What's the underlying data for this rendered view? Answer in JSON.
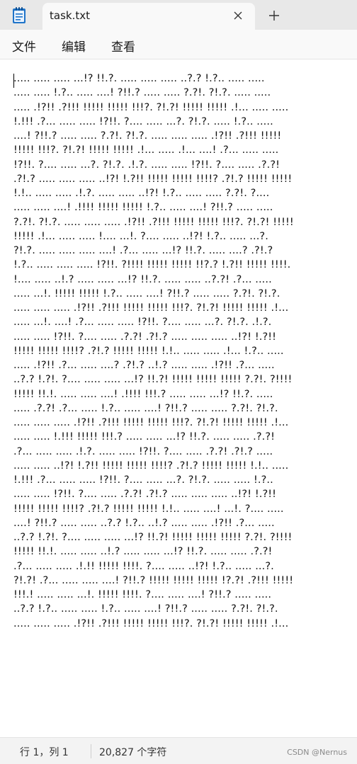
{
  "tab": {
    "title": "task.txt",
    "close_icon": "close-icon",
    "new_tab_icon": "plus-icon"
  },
  "menu": {
    "items": [
      "文件",
      "编辑",
      "查看"
    ]
  },
  "document": {
    "lines": [
      "..... ..... ..... ...!? !!.?. ..... ..... ..... ..?.? !.?.. ..... .....",
      "..... ..... !.?.. ..... ....! ?!!.? ..... ..... ?.?!. ?!.?. ..... .....",
      "..... .!?!! .?!!! !!!!! !!!!! !!!?. ?!.?! !!!!! !!!!! .!... ..... .....",
      "!.!!! .?... ..... ..... !?!!. ?.... ..... ...?. ?!.?. ..... !.?.. .....",
      "....! ?!!.? ..... ..... ?.?!. ?!.?. ..... ..... ..... .!?!! .?!!! !!!!!",
      "!!!!! !!!?. ?!.?! !!!!! !!!!! .!... ..... .!... ....! .?... ..... .....",
      "!?!!. ?.... ..... ...?. ?!.?. .!.?. ..... ..... !?!!. ?.... ..... .?.?!",
      ".?!.? ..... ..... ..... ..!?! !.?!! !!!!! !!!!! !!!!? .?!.? !!!!! !!!!!",
      "!.!.. ..... ..... .!.?. ..... ..... ..!?! !.?.. ..... ..... ?.?!. ?....",
      "..... ..... ....! .!!!! !!!!! !!!!! !.?.. ..... ....! ?!!.? ..... .....",
      "?.?!. ?!.?. ..... ..... ..... .!?!! .?!!! !!!!! !!!!! !!!?. ?!.?! !!!!!",
      "!!!!! .!... ..... ..... !.... ...!. ?.... ..... ..!?! !.?.. ..... ...?.",
      "?!.?. ..... ..... ..... ....! .?... ..... ...!? !!.?. ..... ....? .?!.?",
      "!.?.. ..... ..... ..... !?!!. ?!!!! !!!!! !!!!! !!?.? !.?!! !!!!! !!!!.",
      "!.... ..... ..!.? ..... ..... ...!? !!.?. ..... ..... ..?.?! .?... .....",
      "..... ...!. !!!!! !!!!! !.?.. ..... ....! ?!!.? ..... ..... ?.?!. ?!.?.",
      "..... ..... ..... .!?!! .?!!! !!!!! !!!!! !!!?. ?!.?! !!!!! !!!!! .!...",
      "..... ...!. ....! .?... ..... ..... !?!!. ?.... ..... ...?. ?!.?. .!.?.",
      "..... ..... !?!!. ?.... ..... .?.?! .?!.? ..... ..... ..... ..!?! !.?!!",
      "!!!!! !!!!! !!!!? .?!.? !!!!! !!!!! !.!.. ..... ..... .!... !.?.. .....",
      "..... .!?!! .?... ..... ....? .?!.? ..!.? ..... ..... .!?!! .?... .....",
      "..?.? !.?!. ?.... ..... ..... ...!? !!.?! !!!!! !!!!! !!!!! ?.?!. ?!!!!",
      "!!!!! !!.!. ..... ..... ....! .!!!! !!!.? ..... ..... ...!? !!.?. .....",
      "..... .?.?! .?... ..... !.?.. ..... ....! ?!!.? ..... ..... ?.?!. ?!.?.",
      "..... ..... ..... .!?!! .?!!! !!!!! !!!!! !!!?. ?!.?! !!!!! !!!!! .!...",
      "..... ..... !.!!! !!!!! !!!.? ..... ..... ...!? !!.?. ..... ..... .?.?!",
      ".?... ..... ..... .!.?. ..... ..... !?!!. ?.... ..... .?.?! .?!.? .....",
      "..... ..... ..!?! !.?!! !!!!! !!!!! !!!!? .?!.? !!!!! !!!!! !.!.. .....",
      "!.!!! .?... ..... ..... !?!!. ?.... ..... ...?. ?!.?. ..... ..... !.?..",
      "..... ..... !?!!. ?.... ..... .?.?! .?!.? ..... ..... ..... ..!?! !.?!!",
      "!!!!! !!!!! !!!!? .?!.? !!!!! !!!!! !.!.. ..... ....! ...!. ?.... .....",
      "....! ?!!.? ..... ..... ..?.? !.?.. ..!.? ..... ..... .!?!! .?... .....",
      "..?.? !.?!. ?.... ..... ..... ...!? !!.?! !!!!! !!!!! !!!!! ?.?!. ?!!!!",
      "!!!!! !!.!. ..... ..... ..!.? ..... ..... ...!? !!.?. ..... ..... .?.?!",
      ".?... ..... ..... .!.!! !!!!! !!!!. ?.... ..... ..!?! !.?.. ..... ...?.",
      "?!.?! .?... ..... ..... ....! ?!!.? !!!!! !!!!! !!!!! !?.?! .?!!! !!!!!",
      "!!!.! ..... ..... ...!. !!!!! !!!!. ?.... ..... ....! ?!!.? ..... .....",
      "..?.? !.?.. ..... ..... !.?.. ..... ....! ?!!.? ..... ..... ?.?!. ?!.?.",
      "..... ..... ..... .!?!! .?!!! !!!!! !!!!! !!!?. ?!.?! !!!!! !!!!! .!..."
    ]
  },
  "status": {
    "position": "行 1，列 1",
    "char_count": "20,827 个字符",
    "watermark": "CSDN @Nernus"
  }
}
